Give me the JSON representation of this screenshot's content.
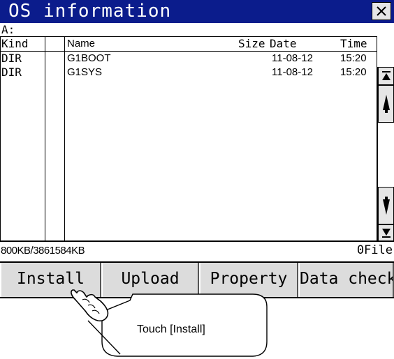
{
  "window": {
    "title": "OS information",
    "drive": "A:"
  },
  "list": {
    "columns": [
      "Kind",
      "Name",
      "Size",
      "Date",
      "Time"
    ],
    "rows": [
      {
        "kind": "DIR",
        "name": "G1BOOT",
        "size": "",
        "date": "11-08-12",
        "time": "15:20"
      },
      {
        "kind": "DIR",
        "name": "G1SYS",
        "size": "",
        "date": "11-08-12",
        "time": "15:20"
      }
    ]
  },
  "status": {
    "capacity": "800KB/3861584KB",
    "file_count": "0File"
  },
  "buttons": {
    "install": "Install",
    "upload": "Upload",
    "property": "Property",
    "data_check": "Data check"
  },
  "callout": {
    "text": "Touch [Install]"
  },
  "colors": {
    "titlebar": "#0b1c8c",
    "button_face": "#dcdcdc"
  },
  "icons": [
    "close-icon",
    "scroll-top-icon",
    "page-up-icon",
    "page-down-icon",
    "scroll-bottom-icon",
    "hand-pointer-icon"
  ]
}
